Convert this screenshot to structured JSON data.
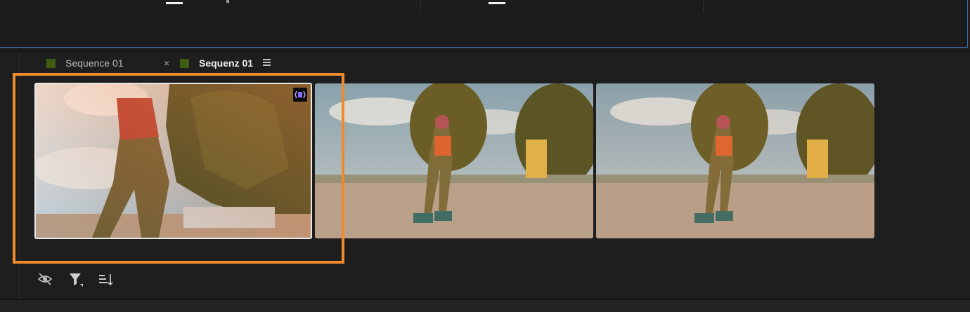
{
  "tabs": [
    {
      "label": "Sequence 01",
      "active": false,
      "swatch_color": "#3f5c12"
    },
    {
      "label": "Sequenz 01",
      "active": true,
      "swatch_color": "#3f5c12"
    }
  ],
  "tab_close_glyph": "×",
  "clips": [
    {
      "name": "clip-thumbnail-1",
      "selected": true,
      "badge_icon": "proxy-badge-icon"
    },
    {
      "name": "clip-thumbnail-2",
      "selected": false
    },
    {
      "name": "clip-thumbnail-3",
      "selected": false
    }
  ],
  "controls": [
    "hide-icon",
    "filter-icon",
    "sort-icon"
  ],
  "accent": {
    "highlight": "#f08a2e",
    "panel_border": "#3b6fb0",
    "badge": "#8a6bff"
  }
}
